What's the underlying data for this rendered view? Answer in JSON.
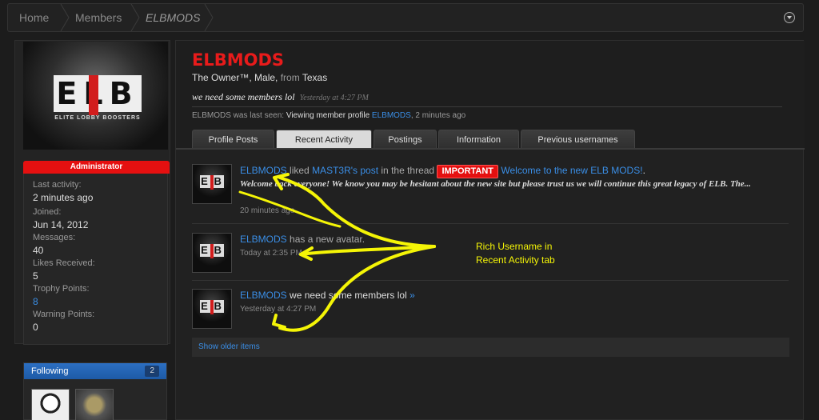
{
  "breadcrumb": {
    "home": "Home",
    "members": "Members",
    "current": "ELBMODS"
  },
  "sidebar": {
    "logo_text": "ELB",
    "logo_subtitle": "ELITE LOBBY BOOSTERS",
    "role": "Administrator",
    "stats": [
      {
        "label": "Last activity:",
        "value": "2 minutes ago"
      },
      {
        "label": "Joined:",
        "value": "Jun 14, 2012"
      },
      {
        "label": "Messages:",
        "value": "40"
      },
      {
        "label": "Likes Received:",
        "value": "5"
      },
      {
        "label": "Trophy Points:",
        "value": "8"
      },
      {
        "label": "Warning Points:",
        "value": "0"
      }
    ],
    "following": {
      "label": "Following",
      "count": "2"
    }
  },
  "profile": {
    "username": "ELBMODS",
    "title": "The Owner™, Male,",
    "from_label": "from",
    "location": "Texas",
    "status_text": "we need some members lol",
    "status_time": "Yesterday at 4:27 PM",
    "last_seen_prefix": "ELBMODS was last seen:",
    "last_seen_action": "Viewing member profile",
    "last_seen_link": "ELBMODS",
    "last_seen_suffix": ", 2 minutes ago"
  },
  "tabs": [
    {
      "label": "Profile Posts"
    },
    {
      "label": "Recent Activity"
    },
    {
      "label": "Postings"
    },
    {
      "label": "Information"
    },
    {
      "label": "Previous usernames"
    }
  ],
  "activity": [
    {
      "user": "ELBMODS",
      "verb": "liked",
      "post_link": "MAST3R's post",
      "in_thread": "in the thread",
      "prefix_badge": "IMPORTANT",
      "thread": "Welcome to the new ELB MODS!",
      "end": ".",
      "snippet": "Welcome back everyone! We know you may be hesitant about the new site but please trust us we will continue this great legacy of ELB. The...",
      "time": "20 minutes ago"
    },
    {
      "user": "ELBMODS",
      "text": "has a new avatar.",
      "time": "Today at 2:35 PM"
    },
    {
      "user": "ELBMODS",
      "text": "we need some members lol",
      "arrow": "»",
      "time": "Yesterday at 4:27 PM"
    }
  ],
  "show_older": "Show older items",
  "annotation": {
    "line1": "Rich Username in",
    "line2": "Recent Activity tab",
    "color": "#f5f506"
  },
  "colors": {
    "accent_red": "#e81b1b",
    "link_blue": "#3a8ee6"
  }
}
